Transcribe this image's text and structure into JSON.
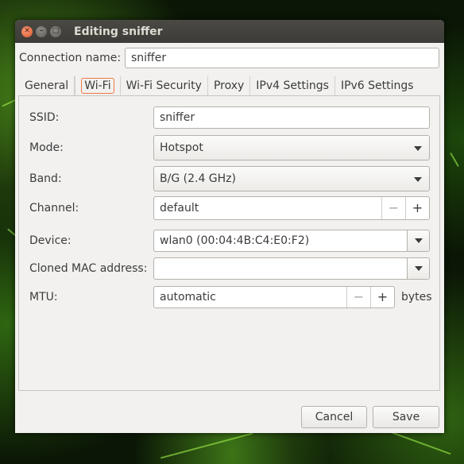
{
  "window": {
    "title": "Editing sniffer"
  },
  "connection": {
    "label": "Connection name:",
    "value": "sniffer"
  },
  "tabs": [
    {
      "label": "General"
    },
    {
      "label": "Wi-Fi",
      "active": true
    },
    {
      "label": "Wi-Fi Security"
    },
    {
      "label": "Proxy"
    },
    {
      "label": "IPv4 Settings"
    },
    {
      "label": "IPv6 Settings"
    }
  ],
  "wifi": {
    "ssid": {
      "label": "SSID:",
      "value": "sniffer"
    },
    "mode": {
      "label": "Mode:",
      "value": "Hotspot"
    },
    "band": {
      "label": "Band:",
      "value": "B/G (2.4 GHz)"
    },
    "channel": {
      "label": "Channel:",
      "value": "default",
      "minus": "−",
      "plus": "+"
    },
    "device": {
      "label": "Device:",
      "value": "wlan0 (00:04:4B:C4:E0:F2)"
    },
    "cloned_mac": {
      "label": "Cloned MAC address:",
      "value": ""
    },
    "mtu": {
      "label": "MTU:",
      "value": "automatic",
      "minus": "−",
      "plus": "+",
      "unit": "bytes"
    }
  },
  "buttons": {
    "cancel": "Cancel",
    "save": "Save"
  },
  "icons": {
    "close": "close-icon",
    "minimize": "minimize-icon",
    "maximize": "maximize-icon",
    "dropdown": "chevron-down-icon"
  },
  "colors": {
    "accent": "#f07746",
    "titlebar": "#3c3b37",
    "window_bg": "#f2f1f0"
  }
}
